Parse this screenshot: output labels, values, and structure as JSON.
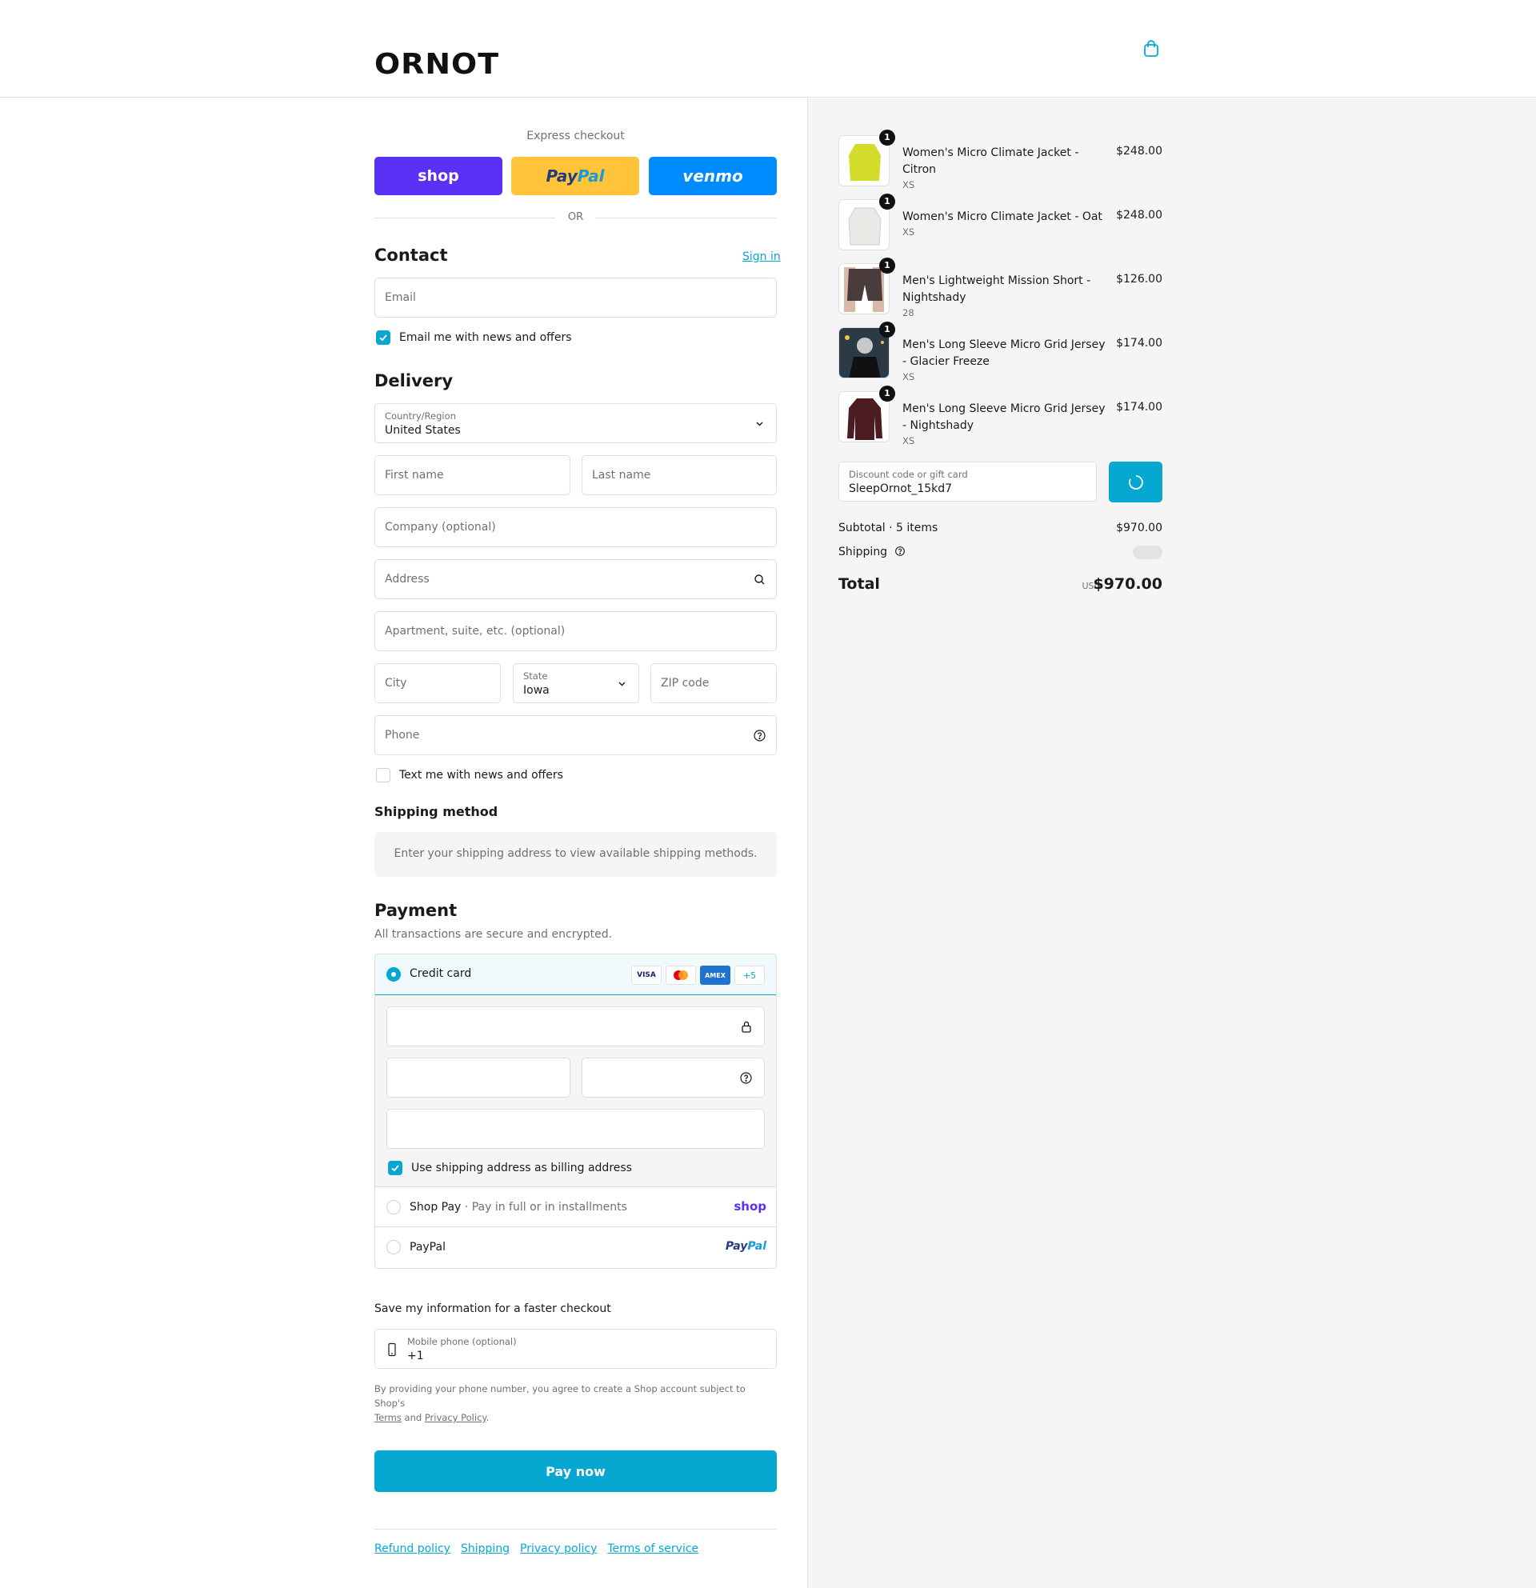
{
  "header": {
    "logo_text": "ORNOT",
    "cart_icon": "shopping-bag-icon"
  },
  "express": {
    "title": "Express checkout",
    "shop_label": "shop",
    "paypal_label_1": "Pay",
    "paypal_label_2": "Pal",
    "venmo_label": "venmo",
    "or_text": "OR"
  },
  "contact": {
    "title": "Contact",
    "sign_in": "Sign in",
    "email_placeholder": "Email",
    "news_checkbox_label": "Email me with news and offers",
    "news_checked": true
  },
  "delivery": {
    "title": "Delivery",
    "country_label": "Country/Region",
    "country_value": "United States",
    "first_name_placeholder": "First name",
    "last_name_placeholder": "Last name",
    "company_placeholder": "Company (optional)",
    "address_placeholder": "Address",
    "apartment_placeholder": "Apartment, suite, etc. (optional)",
    "city_placeholder": "City",
    "state_label": "State",
    "state_value": "Iowa",
    "zip_placeholder": "ZIP code",
    "phone_placeholder": "Phone",
    "text_checkbox_label": "Text me with news and offers",
    "text_checked": false
  },
  "shipping_method": {
    "title": "Shipping method",
    "message": "Enter your shipping address to view available shipping methods."
  },
  "payment": {
    "title": "Payment",
    "subtitle": "All transactions are secure and encrypted.",
    "credit_card_label": "Credit card",
    "card_brands": [
      "VISA",
      "MC",
      "AMEX"
    ],
    "more_cards": "+5",
    "billing_checkbox_label": "Use shipping address as billing address",
    "billing_checked": true,
    "shop_pay_label": "Shop Pay",
    "shop_pay_sub": "Pay in full or in installments",
    "shop_pay_logo": "shop",
    "paypal_label": "PayPal",
    "paypal_logo_1": "Pay",
    "paypal_logo_2": "Pal"
  },
  "save_info": {
    "title": "Save my information for a faster checkout",
    "mobile_label": "Mobile phone (optional)",
    "mobile_value": "+1",
    "legal_text": "By providing your phone number, you agree to create a Shop account subject to Shop's",
    "terms": "Terms",
    "and": "and",
    "privacy": "Privacy Policy"
  },
  "pay_now": "Pay now",
  "footer_links": [
    "Refund policy",
    "Shipping",
    "Privacy policy",
    "Terms of service"
  ],
  "summary": {
    "items": [
      {
        "name": "Women's Micro Climate Jacket - Citron",
        "variant": "XS",
        "price": "$248.00",
        "qty": "1",
        "color": "#d4dc2b"
      },
      {
        "name": "Women's Micro Climate Jacket - Oat",
        "variant": "XS",
        "price": "$248.00",
        "qty": "1",
        "color": "#e9e9e6"
      },
      {
        "name": "Men's Lightweight Mission Short - Nightshady",
        "variant": "28",
        "price": "$126.00",
        "qty": "1",
        "color": "#4a3b3c"
      },
      {
        "name": "Men's Long Sleeve Micro Grid Jersey - Glacier Freeze",
        "variant": "XS",
        "price": "$174.00",
        "qty": "1",
        "color": "#2b3a47"
      },
      {
        "name": "Men's Long Sleeve Micro Grid Jersey - Nightshady",
        "variant": "XS",
        "price": "$174.00",
        "qty": "1",
        "color": "#4b1d22"
      }
    ],
    "discount_label": "Discount code or gift card",
    "discount_value": "SleepOrnot_15kd7",
    "subtotal_label": "Subtotal · 5 items",
    "subtotal_value": "$970.00",
    "shipping_label": "Shipping",
    "total_label": "Total",
    "total_currency": "USD",
    "total_value": "$970.00"
  },
  "colors": {
    "accent": "#06a7d1",
    "shop": "#5a31f4",
    "paypal": "#ffc439",
    "venmo": "#008cff"
  }
}
